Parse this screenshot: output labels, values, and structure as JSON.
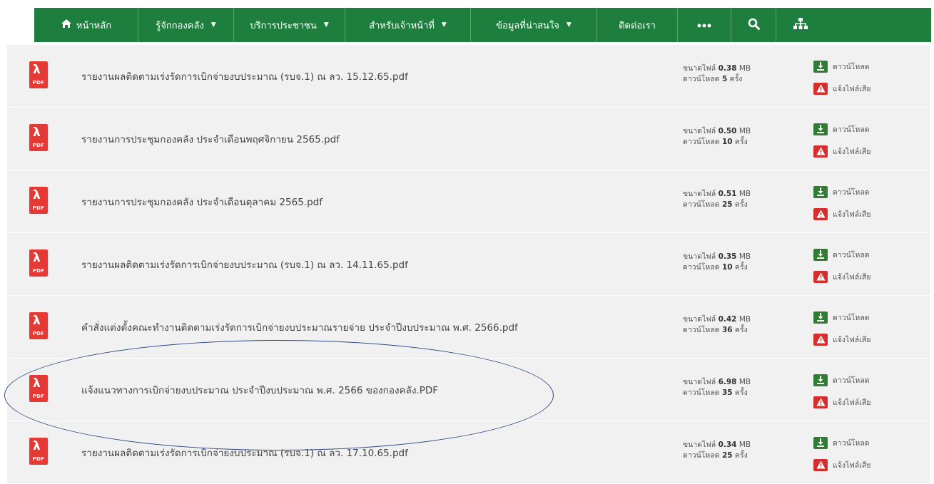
{
  "nav": {
    "items": [
      {
        "label": "หน้าหลัก",
        "icon": "home-icon",
        "chevron": false,
        "width": 145
      },
      {
        "label": "รู้จักกองคลัง",
        "chevron": true,
        "width": 133
      },
      {
        "label": "บริการประชาชน",
        "chevron": true,
        "width": 155
      },
      {
        "label": "สำหรับเจ้าหน้าที่",
        "chevron": true,
        "width": 175
      },
      {
        "label": "ข้อมูลที่น่าสนใจ",
        "chevron": true,
        "width": 176
      },
      {
        "label": "ติดต่อเรา",
        "chevron": false,
        "width": 112
      }
    ],
    "more_icon": "more-icon",
    "search_icon": "search-icon",
    "sitemap_icon": "sitemap-icon",
    "color": "#1e7e3e"
  },
  "labels": {
    "size_prefix": "ขนาดไฟล์",
    "size_unit": "MB",
    "downloads_prefix": "ดาวน์โหลด",
    "downloads_unit": "ครั้ง",
    "download_button": "ดาวน์โหลด",
    "report_button": "แจ้งไฟล์เสีย",
    "pdf_tag": "PDF"
  },
  "files": [
    {
      "name": "รายงานผลติดตามเร่งรัดการเบิกจ่ายงบประมาณ (รบจ.1) ณ ลว. 15.12.65.pdf",
      "size": "0.38",
      "downloads": "5"
    },
    {
      "name": "รายงานการประชุมกองคลัง ประจำเดือนพฤศจิกายน 2565.pdf",
      "size": "0.50",
      "downloads": "10"
    },
    {
      "name": "รายงานการประชุมกองคลัง ประจำเดือนตุลาคม 2565.pdf",
      "size": "0.51",
      "downloads": "25"
    },
    {
      "name": "รายงานผลติดตามเร่งรัดการเบิกจ่ายงบประมาณ (รบจ.1) ณ ลว. 14.11.65.pdf",
      "size": "0.35",
      "downloads": "10"
    },
    {
      "name": "คำสั่งแต่งตั้งคณะทำงานติดตามเร่งรัดการเบิกจ่ายงบประมาณรายจ่าย ประจำปีงบประมาณ พ.ศ. 2566.pdf",
      "size": "0.42",
      "downloads": "36"
    },
    {
      "name": "แจ้งแนวทางการเบิกจ่ายงบประมาณ ประจำปีงบประมาณ พ.ศ. 2566 ของกองคลัง.PDF",
      "size": "6.98",
      "downloads": "35"
    },
    {
      "name": "รายงานผลติดตามเร่งรัดการเบิกจ่ายงบประมาณ (รบจ.1) ณ ลว. 17.10.65.pdf",
      "size": "0.34",
      "downloads": "25"
    }
  ]
}
